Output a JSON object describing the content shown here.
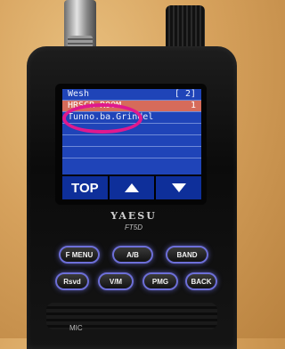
{
  "lcd": {
    "rows": [
      {
        "text": "Wesh",
        "num": "[ 2]"
      },
      {
        "text": "HRSCR-ROOM",
        "num": "1"
      },
      {
        "text": "Tunno.ba.Grindel",
        "num": ""
      },
      {
        "text": "",
        "num": ""
      },
      {
        "text": "",
        "num": ""
      },
      {
        "text": "",
        "num": ""
      }
    ],
    "selected_index": 1
  },
  "softkeys": {
    "top_label": "TOP"
  },
  "branding": {
    "brand": "YAESU",
    "model": "FT5D"
  },
  "keys": {
    "f_menu": "F MENU",
    "ab": "A/B",
    "band": "BAND",
    "back_label": "BACK",
    "vm": "V/M",
    "pmg": "PMG",
    "left_small": "Rsvd"
  },
  "mic_label": "MIC",
  "colors": {
    "lcd_bg": "#1f44b8",
    "lcd_selected": "#d66b5a",
    "highlight_ring": "#e0198e",
    "key_glow": "#6d6fd8"
  }
}
